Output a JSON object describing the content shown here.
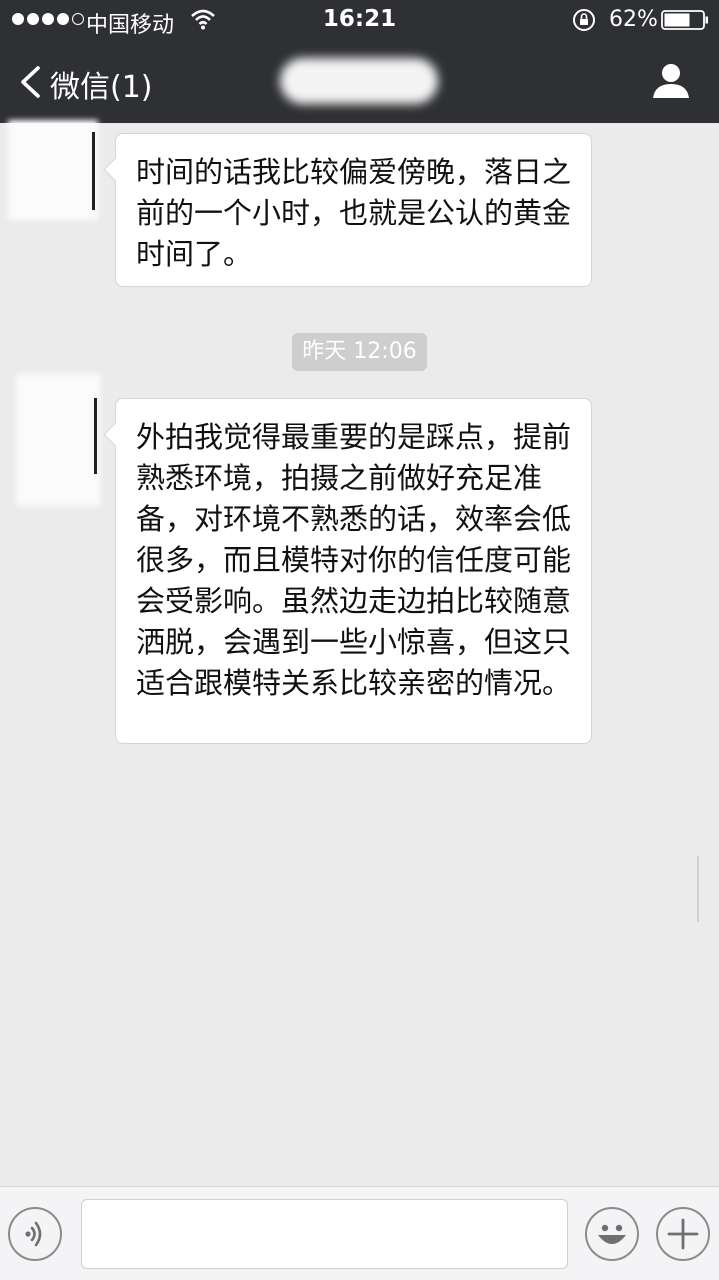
{
  "status_bar": {
    "carrier": "中国移动",
    "time": "16:21",
    "battery": "62%",
    "icons": [
      "signal-icon",
      "wifi-icon",
      "rotation-lock-icon",
      "battery-icon"
    ]
  },
  "nav_bar": {
    "back_label": "微信(1)",
    "icons": [
      "back-chevron-icon",
      "contact-info-icon"
    ]
  },
  "messages": [
    {
      "side": "left",
      "text": "时间的话我比较偏爱傍晚，落日之前的一个小时，也就是公认的黄金时间了。"
    },
    {
      "side": "left",
      "text": "外拍我觉得最重要的是踩点，提前熟悉环境，拍摄之前做好充足准备，对环境不熟悉的话，效率会低很多，而且模特对你的信任度可能会受影响。虽然边走边拍比较随意洒脱，会遇到一些小惊喜，但这只适合跟模特关系比较亲密的情况。"
    }
  ],
  "timestamp": "昨天 12:06",
  "input_bar": {
    "icons": [
      "voice-icon",
      "emoji-icon",
      "plus-icon"
    ]
  },
  "colors": {
    "top_bar": "#2e3033",
    "background": "#ebebeb",
    "bubble": "#ffffff",
    "timestamp_bg": "#cecece"
  }
}
